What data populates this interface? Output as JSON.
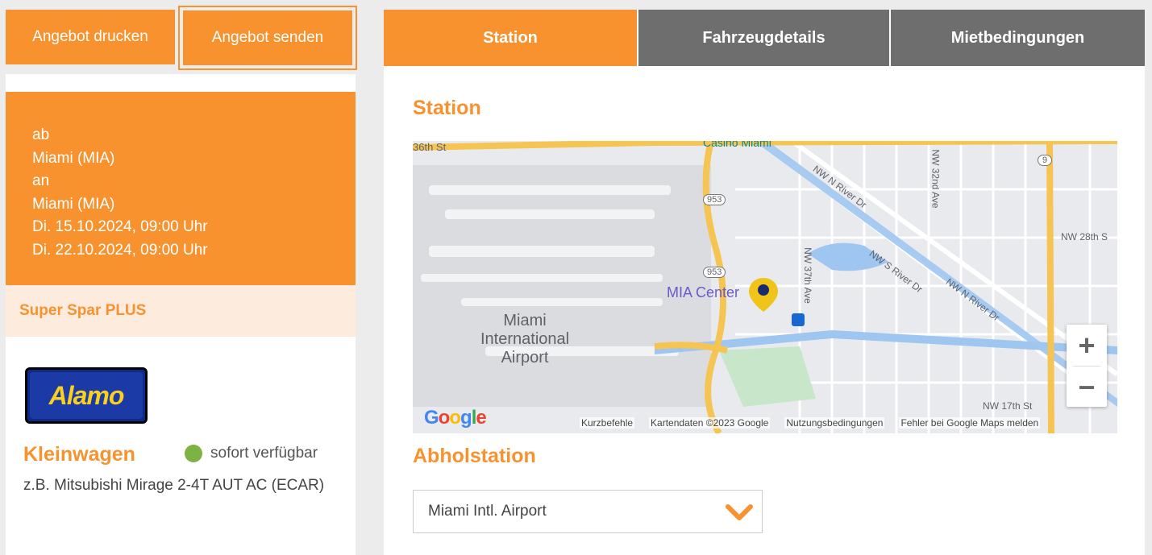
{
  "actions": {
    "print_label": "Angebot drucken",
    "send_label": "Angebot senden"
  },
  "trip": {
    "from_label": "ab",
    "from_location": "Miami (MIA)",
    "to_label": "an",
    "to_location": "Miami (MIA)",
    "pickup_datetime": "Di. 15.10.2024, 09:00 Uhr",
    "return_datetime": "Di. 22.10.2024, 09:00 Uhr"
  },
  "tariff": "Super Spar PLUS",
  "vendor": {
    "name": "Alamo"
  },
  "car": {
    "class": "Kleinwagen",
    "availability": "sofort verfügbar",
    "model": "z.B. Mitsubishi Mirage 2-4T AUT AC (ECAR)"
  },
  "tabs": [
    {
      "label": "Station",
      "active": true
    },
    {
      "label": "Fahrzeugdetails",
      "active": false
    },
    {
      "label": "Mietbedingungen",
      "active": false
    }
  ],
  "station_heading": "Station",
  "map": {
    "labels": {
      "airport_l1": "Miami",
      "airport_l2": "International",
      "airport_l3": "Airport",
      "mia_center": "MIA Center",
      "nw_n_river_dr_1": "NW N River Dr",
      "nw_s_river_dr": "NW S River Dr",
      "nw_n_river_dr_2": "NW N River Dr",
      "nw_37th_ave": "NW 37th Ave",
      "nw_32nd_ave": "NW 32nd Ave",
      "nw_28th": "NW 28th S",
      "nw_17th": "NW 17th St",
      "st_36th": "36th St",
      "casino": "Casino Miami",
      "route_953a": "953",
      "route_953b": "953",
      "route_9": "9"
    },
    "footer": {
      "shortcuts": "Kurzbefehle",
      "map_data": "Kartendaten ©2023 Google",
      "terms": "Nutzungsbedingungen",
      "report": "Fehler bei Google Maps melden"
    },
    "colors": {
      "water": "#9fc6f0",
      "highway": "#f5c453",
      "land": "#e8eaed",
      "marker": "#f0c419"
    }
  },
  "pickup_heading": "Abholstation",
  "pickup_select": {
    "value": "Miami Intl. Airport"
  },
  "colors": {
    "accent": "#f7922f",
    "tab_inactive": "#6e6e6e",
    "tariff_bg": "#fdebdd"
  }
}
